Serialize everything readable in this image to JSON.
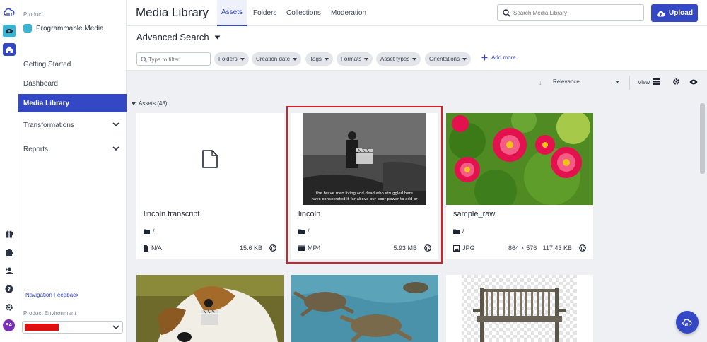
{
  "colors": {
    "accent": "#3448c5",
    "selection": "#d71f26",
    "product_icon": "#3bb4d4",
    "avatar": "#7b2fb8"
  },
  "rail": {
    "icons": [
      "cloudinary-logo-icon",
      "programmable-media-icon",
      "home-icon",
      "gift-icon",
      "puzzle-icon",
      "add-user-icon",
      "help-icon",
      "settings-icon"
    ],
    "avatar_initials": "SA"
  },
  "sidebar": {
    "product_label": "Product",
    "product_name": "Programmable Media",
    "items": [
      {
        "label": "Getting Started",
        "expandable": false,
        "active": false
      },
      {
        "label": "Dashboard",
        "expandable": false,
        "active": false
      },
      {
        "label": "Media Library",
        "expandable": false,
        "active": true
      },
      {
        "label": "Transformations",
        "expandable": true,
        "active": false
      },
      {
        "label": "Reports",
        "expandable": true,
        "active": false
      }
    ],
    "feedback_link": "Navigation Feedback",
    "env_label": "Product Environment"
  },
  "header": {
    "title": "Media Library",
    "tabs": [
      {
        "label": "Assets",
        "active": true
      },
      {
        "label": "Folders",
        "active": false
      },
      {
        "label": "Collections",
        "active": false
      },
      {
        "label": "Moderation",
        "active": false
      }
    ],
    "search_placeholder": "Search Media Library",
    "upload_label": "Upload"
  },
  "filters": {
    "title": "Advanced Search",
    "filter_placeholder": "Type to filter",
    "chips": [
      "Folders",
      "Creation date",
      "Tags",
      "Formats",
      "Asset types",
      "Orientations"
    ],
    "add_more": "Add more"
  },
  "toolbar": {
    "sort_label": "Relevance",
    "view_label": "View"
  },
  "assets": {
    "header": "Assets (48)",
    "cards": [
      {
        "name": "lincoln.transcript",
        "folder": "/",
        "type": "N/A",
        "dims": "",
        "size": "15.6 KB",
        "thumb": "document",
        "selected": false
      },
      {
        "name": "lincoln",
        "folder": "/",
        "type": "MP4",
        "dims": "",
        "size": "5.93 MB",
        "thumb": "video",
        "selected": true,
        "subtitle_lines": [
          "the brave men living and dead who struggled here",
          "have consecrated it far above our poor power to add or"
        ]
      },
      {
        "name": "sample_raw",
        "folder": "/",
        "type": "JPG",
        "dims": "864 × 576",
        "size": "117.43 KB",
        "thumb": "flowers",
        "selected": false
      },
      {
        "thumb": "dog-video"
      },
      {
        "thumb": "turtles"
      },
      {
        "thumb": "bench"
      }
    ]
  }
}
